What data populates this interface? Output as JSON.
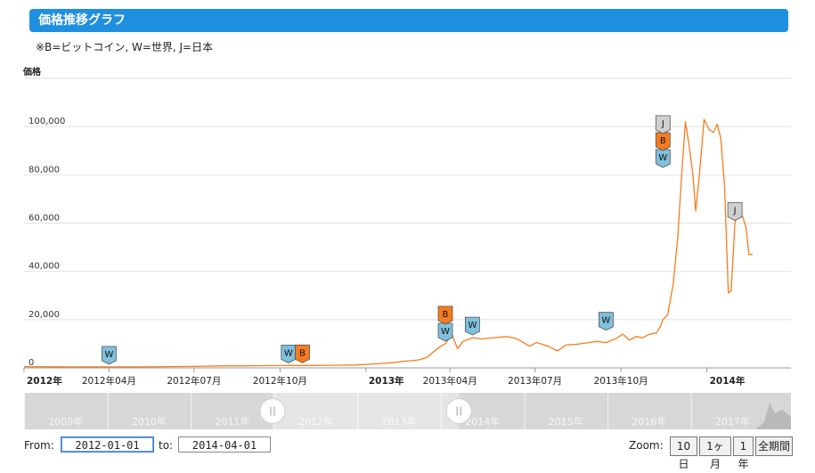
{
  "header": {
    "title": "価格推移グラフ"
  },
  "legend_note": "※B=ビットコイン, W=世界, J=日本",
  "ylabel": "価格",
  "chart_data": {
    "type": "line",
    "ylabel": "価格",
    "ylim": [
      0,
      120000
    ],
    "yticks": [
      {
        "v": 0,
        "label": "0"
      },
      {
        "v": 20000,
        "label": "20,000"
      },
      {
        "v": 40000,
        "label": "40,000"
      },
      {
        "v": 60000,
        "label": "60,000"
      },
      {
        "v": 80000,
        "label": "80,000"
      },
      {
        "v": 100000,
        "label": "100,000"
      }
    ],
    "xlim": [
      "2012-01-01",
      "2014-04-01"
    ],
    "xticks": [
      {
        "date": "2012-01-01",
        "label": "2012年",
        "bold": true
      },
      {
        "date": "2012-04-01",
        "label": "2012年04月",
        "bold": false
      },
      {
        "date": "2012-07-01",
        "label": "2012年07月",
        "bold": false
      },
      {
        "date": "2012-10-01",
        "label": "2012年10月",
        "bold": false
      },
      {
        "date": "2013-01-01",
        "label": "2013年",
        "bold": true
      },
      {
        "date": "2013-04-01",
        "label": "2013年04月",
        "bold": false
      },
      {
        "date": "2013-07-01",
        "label": "2013年07月",
        "bold": false
      },
      {
        "date": "2013-10-01",
        "label": "2013年10月",
        "bold": false
      },
      {
        "date": "2014-01-01",
        "label": "2014年",
        "bold": true
      }
    ],
    "grid": true,
    "series": [
      {
        "color": "#f57c1f",
        "points": [
          [
            "2012-01-01",
            500
          ],
          [
            "2012-02-01",
            450
          ],
          [
            "2012-03-01",
            400
          ],
          [
            "2012-04-01",
            400
          ],
          [
            "2012-05-01",
            420
          ],
          [
            "2012-06-01",
            500
          ],
          [
            "2012-07-01",
            600
          ],
          [
            "2012-08-01",
            850
          ],
          [
            "2012-09-01",
            900
          ],
          [
            "2012-10-01",
            950
          ],
          [
            "2012-11-01",
            1000
          ],
          [
            "2012-12-01",
            1100
          ],
          [
            "2012-12-20",
            1200
          ],
          [
            "2013-01-05",
            1500
          ],
          [
            "2013-01-20",
            1900
          ],
          [
            "2013-02-01",
            2300
          ],
          [
            "2013-02-12",
            2800
          ],
          [
            "2013-02-22",
            3100
          ],
          [
            "2013-03-01",
            3500
          ],
          [
            "2013-03-08",
            4500
          ],
          [
            "2013-03-14",
            6500
          ],
          [
            "2013-03-20",
            8500
          ],
          [
            "2013-03-27",
            10000
          ],
          [
            "2013-04-03",
            14000
          ],
          [
            "2013-04-09",
            8000
          ],
          [
            "2013-04-15",
            11000
          ],
          [
            "2013-04-25",
            12500
          ],
          [
            "2013-05-05",
            12000
          ],
          [
            "2013-05-18",
            12500
          ],
          [
            "2013-06-01",
            13000
          ],
          [
            "2013-06-12",
            12000
          ],
          [
            "2013-06-25",
            9000
          ],
          [
            "2013-07-03",
            10500
          ],
          [
            "2013-07-15",
            9000
          ],
          [
            "2013-07-25",
            7000
          ],
          [
            "2013-08-03",
            9500
          ],
          [
            "2013-08-15",
            9800
          ],
          [
            "2013-08-27",
            10500
          ],
          [
            "2013-09-06",
            11000
          ],
          [
            "2013-09-15",
            10500
          ],
          [
            "2013-09-25",
            12000
          ],
          [
            "2013-10-03",
            14000
          ],
          [
            "2013-10-10",
            11500
          ],
          [
            "2013-10-17",
            13000
          ],
          [
            "2013-10-24",
            12500
          ],
          [
            "2013-11-01",
            14000
          ],
          [
            "2013-11-08",
            14500
          ],
          [
            "2013-11-12",
            17000
          ],
          [
            "2013-11-15",
            20000
          ],
          [
            "2013-11-20",
            22000
          ],
          [
            "2013-11-26",
            35000
          ],
          [
            "2013-12-01",
            55000
          ],
          [
            "2013-12-05",
            80000
          ],
          [
            "2013-12-09",
            102000
          ],
          [
            "2013-12-13",
            92000
          ],
          [
            "2013-12-17",
            80000
          ],
          [
            "2013-12-20",
            65000
          ],
          [
            "2013-12-24",
            80000
          ],
          [
            "2013-12-29",
            103000
          ],
          [
            "2014-01-03",
            99000
          ],
          [
            "2014-01-08",
            97500
          ],
          [
            "2014-01-12",
            101000
          ],
          [
            "2014-01-16",
            95000
          ],
          [
            "2014-01-20",
            75000
          ],
          [
            "2014-01-24",
            31000
          ],
          [
            "2014-01-27",
            32000
          ],
          [
            "2014-01-31",
            60000
          ],
          [
            "2014-02-04",
            65000
          ],
          [
            "2014-02-08",
            63000
          ],
          [
            "2014-02-12",
            58000
          ],
          [
            "2014-02-15",
            47000
          ],
          [
            "2014-02-19",
            47000
          ]
        ]
      }
    ],
    "flags": [
      {
        "date": "2012-04-01",
        "value": 400,
        "text": "W",
        "color": "#7fc0dd",
        "stack": 0
      },
      {
        "date": "2012-10-10",
        "value": 950,
        "text": "W",
        "color": "#7fc0dd",
        "stack": 0
      },
      {
        "date": "2012-10-25",
        "value": 1000,
        "text": "B",
        "color": "#f57c1f",
        "stack": 0
      },
      {
        "date": "2013-03-27",
        "value": 10000,
        "text": "W",
        "color": "#7fc0dd",
        "stack": 0
      },
      {
        "date": "2013-03-27",
        "value": 10000,
        "text": "B",
        "color": "#f57c1f",
        "stack": 1
      },
      {
        "date": "2013-04-25",
        "value": 12500,
        "text": "W",
        "color": "#7fc0dd",
        "stack": 0
      },
      {
        "date": "2013-09-15",
        "value": 14500,
        "text": "W",
        "color": "#7fc0dd",
        "stack": 0
      },
      {
        "date": "2013-11-15",
        "value": 82000,
        "text": "W",
        "color": "#7fc0dd",
        "stack": 0
      },
      {
        "date": "2013-11-15",
        "value": 82000,
        "text": "B",
        "color": "#f57c1f",
        "stack": 1
      },
      {
        "date": "2013-11-15",
        "value": 82000,
        "text": "J",
        "color": "#cfcfcf",
        "stack": 2
      },
      {
        "date": "2014-01-31",
        "value": 60000,
        "text": "J",
        "color": "#cfcfcf",
        "stack": 0
      }
    ]
  },
  "navigator": {
    "years": [
      "2009年",
      "2010年",
      "2011年",
      "2012年",
      "2013年",
      "2014年",
      "2015年",
      "2016年",
      "2017年"
    ],
    "handle_icon": "grip-icon",
    "range_start": 0.324,
    "range_end": 0.567
  },
  "range": {
    "from_label": "From:",
    "from_value": "2012-01-01",
    "to_label": "to:",
    "to_value": "2014-04-01"
  },
  "zoom": {
    "label": "Zoom:",
    "buttons": [
      "10日",
      "1ヶ月",
      "1年",
      "全期間"
    ]
  }
}
